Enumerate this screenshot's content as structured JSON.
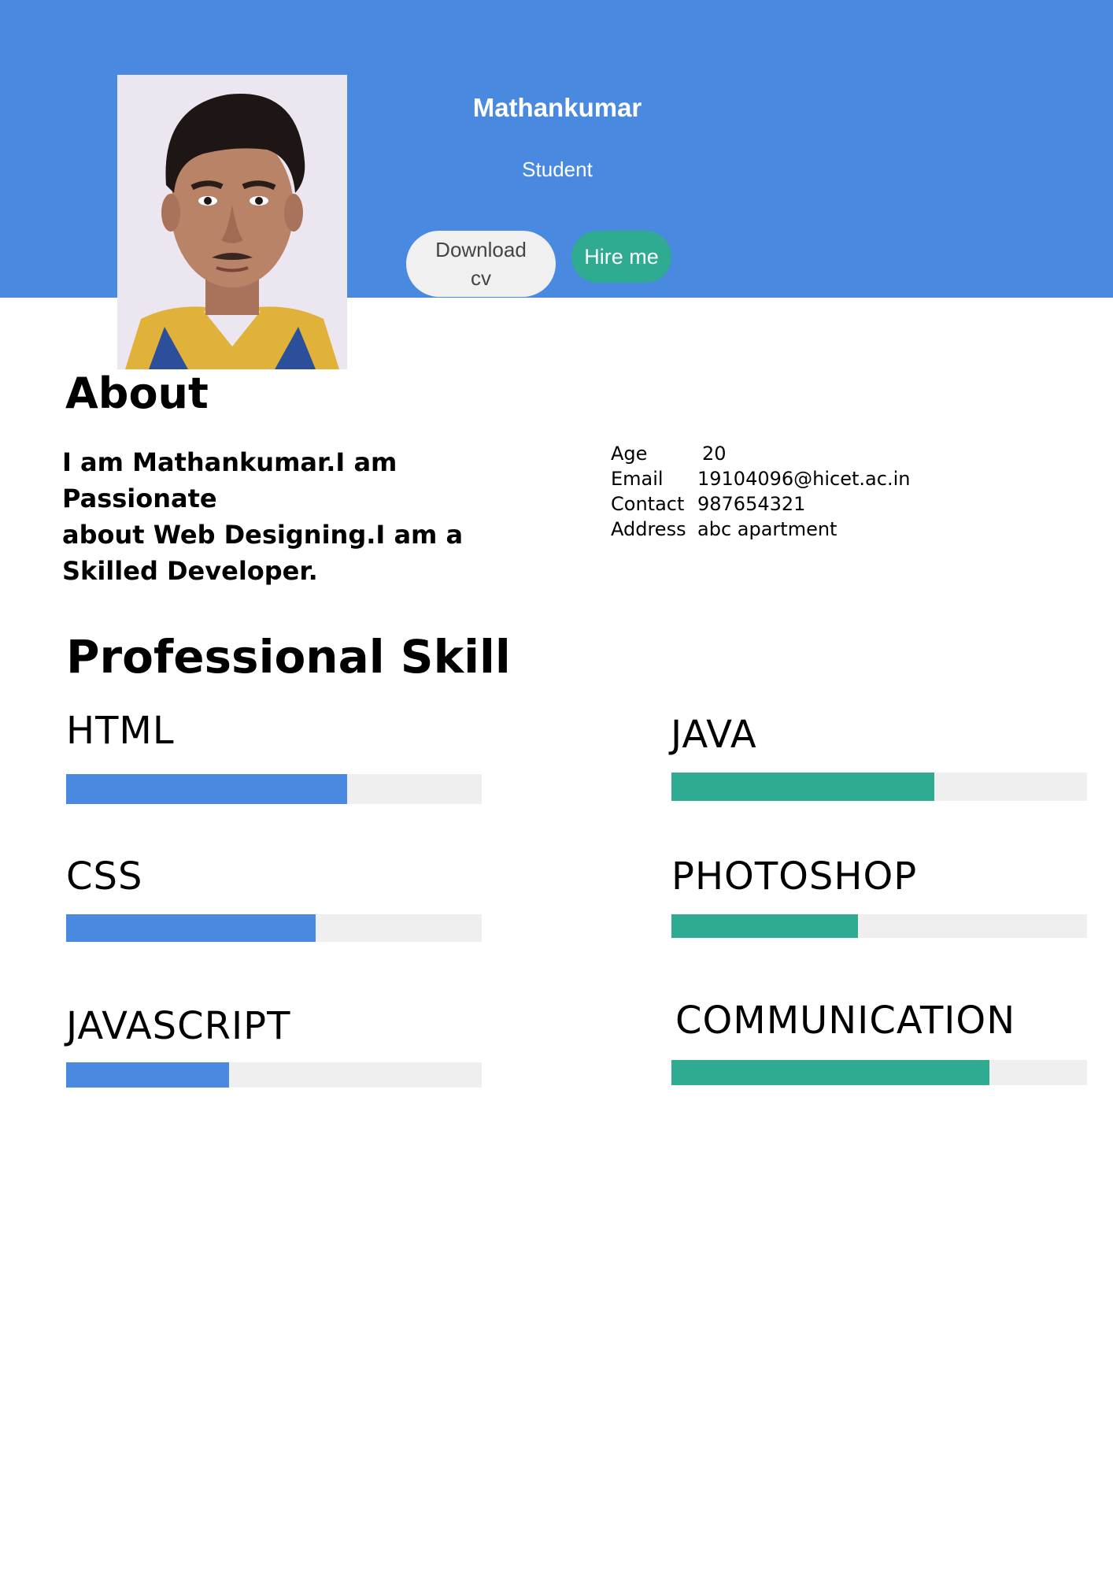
{
  "profile": {
    "name": "Mathankumar",
    "role": "Student",
    "download_label_line1": "Download",
    "download_label_line2": "cv",
    "hire_label": "Hire me"
  },
  "about": {
    "title": "About",
    "text_line1": "I am Mathankumar.I am Passionate",
    "text_line2": "about Web Designing.I am a",
    "text_line3": "Skilled Developer.",
    "info": [
      {
        "key": "Age",
        "value": "20"
      },
      {
        "key": "Email",
        "value": "19104096@hicet.ac.in"
      },
      {
        "key": "Contact",
        "value": "987654321"
      },
      {
        "key": "Address",
        "value": "abc apartment"
      }
    ]
  },
  "skills": {
    "title": "Professional Skill",
    "items": [
      {
        "name": "HTML",
        "level": 0.676,
        "color": "#4a89e0"
      },
      {
        "name": "CSS",
        "level": 0.6,
        "color": "#4a89e0"
      },
      {
        "name": "JAVASCRIPT",
        "level": 0.392,
        "color": "#4a89e0"
      },
      {
        "name": "JAVA",
        "level": 0.633,
        "color": "#2fab92"
      },
      {
        "name": "PHOTOSHOP",
        "level": 0.449,
        "color": "#2fab92"
      },
      {
        "name": "COMMUNICATION",
        "level": 0.766,
        "color": "#2fab92"
      }
    ]
  },
  "colors": {
    "header": "#4a89e0",
    "accent_green": "#2fab92",
    "button_light": "#f0f0f0"
  }
}
